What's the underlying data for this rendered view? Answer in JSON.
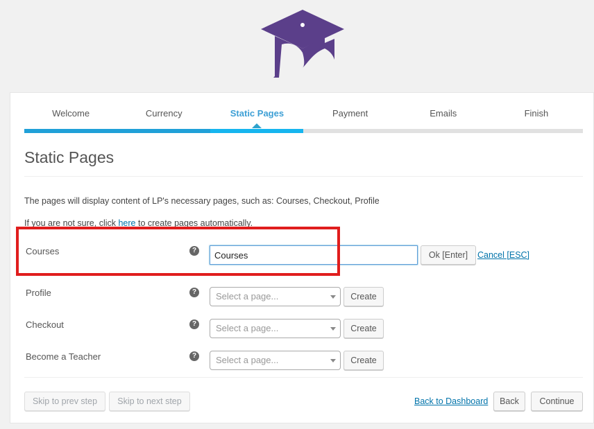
{
  "brand": {
    "logo_icon": "graduation-cap-icon",
    "logo_color": "#5b3f8a"
  },
  "steps": [
    {
      "label": "Welcome",
      "state": "done"
    },
    {
      "label": "Currency",
      "state": "done"
    },
    {
      "label": "Static Pages",
      "state": "active"
    },
    {
      "label": "Payment",
      "state": "todo"
    },
    {
      "label": "Emails",
      "state": "todo"
    },
    {
      "label": "Finish",
      "state": "todo"
    }
  ],
  "progress": {
    "completed_steps": 2,
    "current_step": 3,
    "total_steps": 6
  },
  "page": {
    "title": "Static Pages",
    "description": "The pages will display content of LP's necessary pages, such as: Courses, Checkout, Profile",
    "hint_prefix": "If you are not sure, click ",
    "hint_link": "here",
    "hint_suffix": " to create pages automatically."
  },
  "courses": {
    "label": "Courses",
    "help_icon": "question-circle-icon",
    "input_value": "Courses",
    "ok_label": "Ok [Enter]",
    "cancel_label": "Cancel [ESC]"
  },
  "rows": [
    {
      "label": "Profile",
      "placeholder": "Select a page...",
      "create_label": "Create"
    },
    {
      "label": "Checkout",
      "placeholder": "Select a page...",
      "create_label": "Create"
    },
    {
      "label": "Become a Teacher",
      "placeholder": "Select a page...",
      "create_label": "Create"
    }
  ],
  "footer": {
    "skip_prev": "Skip to prev step",
    "skip_next": "Skip to next step",
    "back_to_dashboard": "Back to Dashboard",
    "back": "Back",
    "continue": "Continue"
  },
  "colors": {
    "accent": "#0073aa",
    "progress": "#20a0d8",
    "highlight": "#e01d1d"
  }
}
